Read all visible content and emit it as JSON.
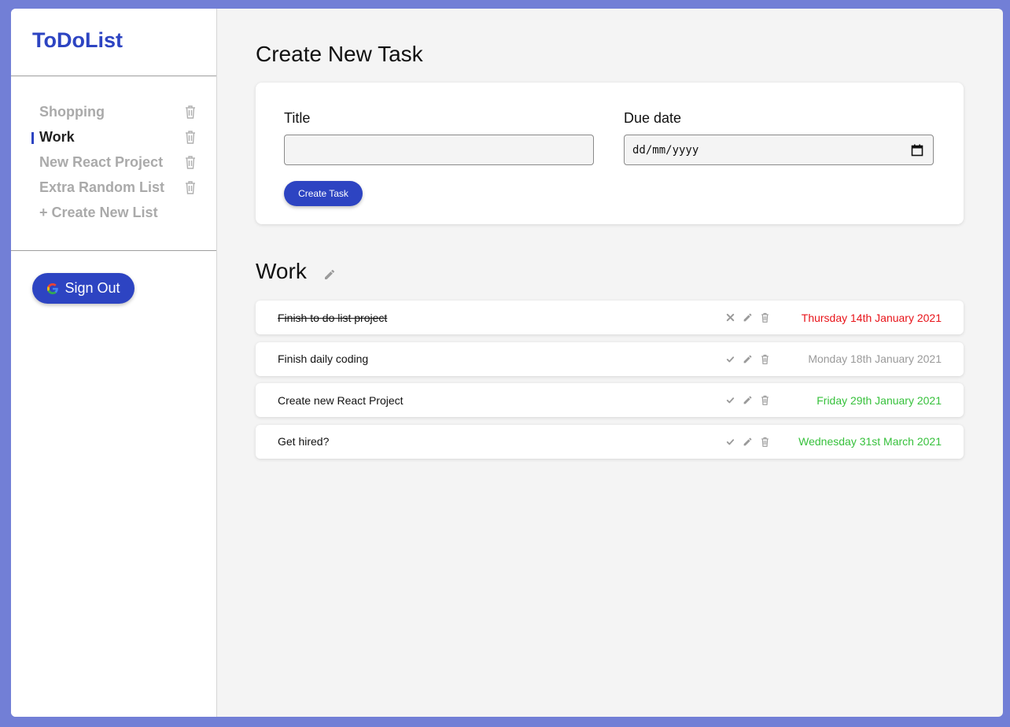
{
  "app": {
    "title": "ToDoList"
  },
  "sidebar": {
    "lists": [
      {
        "label": "Shopping",
        "active": false
      },
      {
        "label": "Work",
        "active": true
      },
      {
        "label": "New React Project",
        "active": false
      },
      {
        "label": "Extra Random List",
        "active": false
      }
    ],
    "create_list_label": "+ Create New List",
    "sign_out_label": "Sign Out",
    "icons": {
      "list_delete": "trash-icon",
      "sign_out": "google-icon"
    }
  },
  "create_task": {
    "heading": "Create New Task",
    "title_label": "Title",
    "title_value": "",
    "due_label": "Due date",
    "due_placeholder": "dd/mm/yyyy",
    "button_label": "Create Task"
  },
  "list_view": {
    "title": "Work",
    "tasks": [
      {
        "title": "Finish to do list project",
        "completed": true,
        "due": "Thursday 14th January 2021",
        "due_color": "#e8141a",
        "status_icon": "close-icon"
      },
      {
        "title": "Finish daily coding",
        "completed": false,
        "due": "Monday 18th January 2021",
        "due_color": "#9a9a9a",
        "status_icon": "check-icon"
      },
      {
        "title": "Create new React Project",
        "completed": false,
        "due": "Friday 29th January 2021",
        "due_color": "#37c13c",
        "status_icon": "check-icon"
      },
      {
        "title": "Get hired?",
        "completed": false,
        "due": "Wednesday 31st March 2021",
        "due_color": "#37c13c",
        "status_icon": "check-icon"
      }
    ]
  },
  "colors": {
    "accent": "#2d44c2",
    "frame": "#727fd6",
    "overdue": "#e8141a",
    "upcoming": "#37c13c",
    "muted": "#9a9a9a"
  }
}
